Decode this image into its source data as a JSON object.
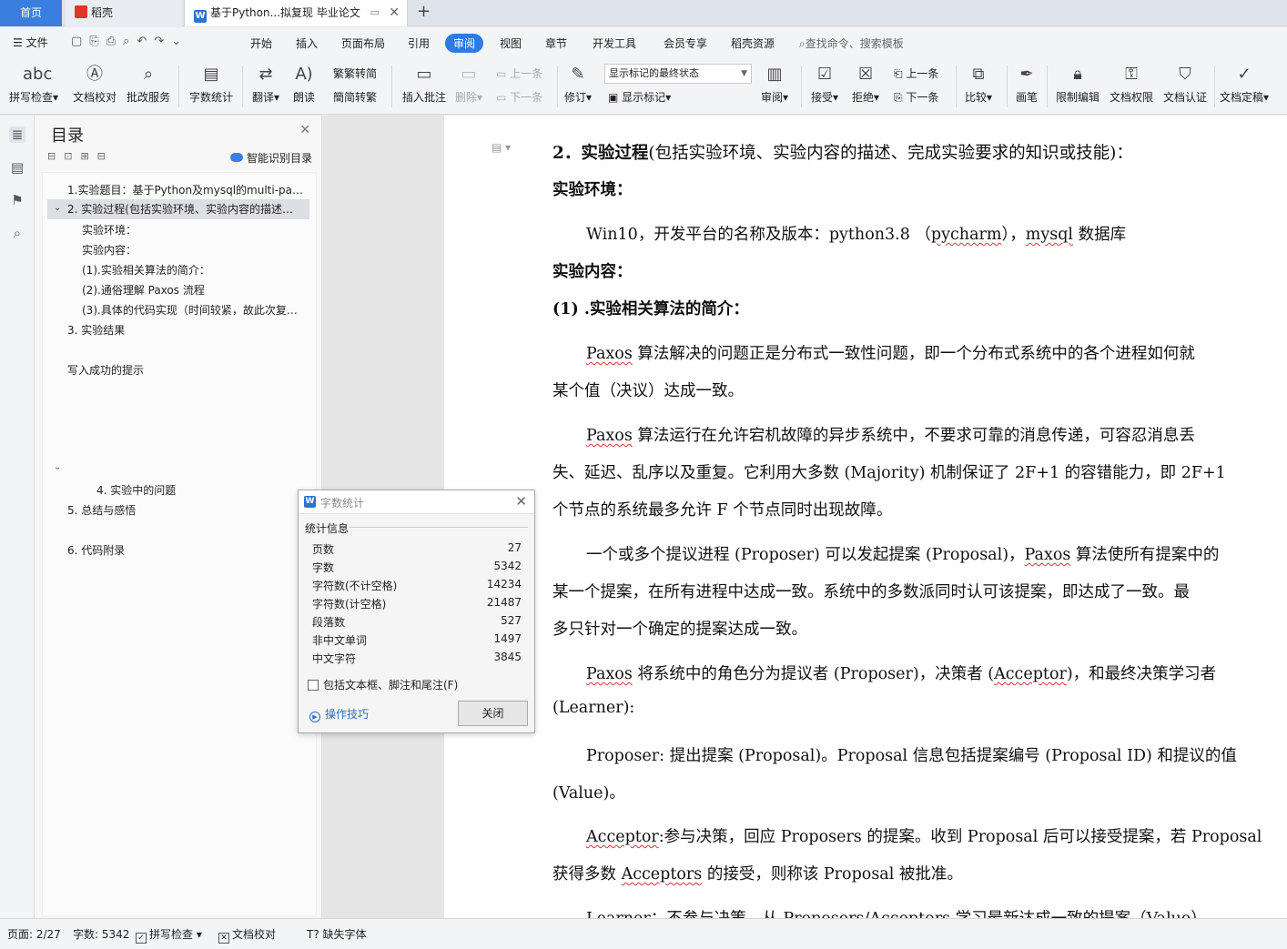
{
  "tabs": {
    "home": "首页",
    "daoke": "稻壳",
    "doc": "基于Python...拟复现 毕业论文"
  },
  "menu": {
    "file": "文件",
    "items": [
      "开始",
      "插入",
      "页面布局",
      "引用",
      "审阅",
      "视图",
      "章节",
      "开发工具",
      "会员专享",
      "稻壳资源"
    ],
    "active": "审阅",
    "search_placeholder": "查找命令、搜索模板"
  },
  "ribbon": {
    "spell": "拼写检查",
    "proof": "文档校对",
    "batch": "批改服务",
    "wordcount": "字数统计",
    "translate": "翻译",
    "read": "朗读",
    "trad": "繁转简",
    "simp": "简转繁",
    "insert_comment": "插入批注",
    "delete": "删除",
    "prev": "上一条",
    "next": "下一条",
    "revise": "修订",
    "markup_select": "显示标记的最终状态",
    "show_markup": "显示标记",
    "review": "审阅",
    "accept": "接受",
    "reject": "拒绝",
    "prev2": "上一条",
    "next2": "下一条",
    "compare": "比较",
    "pen": "画笔",
    "restrict": "限制编辑",
    "permission": "文档权限",
    "certify": "文档认证",
    "finalize": "文档定稿"
  },
  "toc": {
    "title": "目录",
    "smart": "智能识别目录",
    "items": [
      "1.实验题目：基于Python及mysql的multi-pa…",
      "2. 实验过程(包括实验环境、实验内容的描述…",
      "实验环境：",
      "实验内容：",
      "(1).实验相关算法的简介：",
      "(2).通俗理解 Paxos 流程",
      "(3).具体的代码实现（时间较紧，故此次复…",
      "3. 实验结果",
      "写入成功的提示",
      "4. 实验中的问题",
      "5. 总结与感悟",
      "6. 代码附录"
    ]
  },
  "doc": {
    "h2": "2．实验过程",
    "h2_rest": "(包括实验环境、实验内容的描述、完成实验要求的知识或技能)：",
    "env_title": "实验环境：",
    "env_text_a": "Win10，开发平台的名称及版本：python3.8 （",
    "env_pycharm": "pycharm",
    "env_text_b": "），",
    "env_mysql": "mysql",
    "env_text_c": " 数据库",
    "content_title": "实验内容：",
    "algo_title": "(1) .实验相关算法的简介：",
    "paxos": "Paxos",
    "p1a_rest": " 算法解决的问题正是分布式一致性问题，即一个分布式系统中的各个进程如何就",
    "p1b": "某个值（决议）达成一致。",
    "p2a_rest": " 算法运行在允许宕机故障的异步系统中，不要求可靠的消息传递，可容忍消息丢",
    "p2b": "失、延迟、乱序以及重复。它利用大多数 (Majority) 机制保证了 2F+1 的容错能力，即 2F+1",
    "p2c": "个节点的系统最多允许 F 个节点同时出现故障。",
    "p3a_pre": "一个或多个提议进程 (Proposer) 可以发起提案 (Proposal)，",
    "p3a_post": " 算法使所有提案中的",
    "p3b": "某一个提案，在所有进程中达成一致。系统中的多数派同时认可该提案，即达成了一致。最",
    "p3c": "多只针对一个确定的提案达成一致。",
    "p4a_mid": " 将系统中的角色分为提议者 (Proposer)，决策者 (",
    "acceptor": "Acceptor",
    "p4a_end": ")，和最终决策学习者",
    "p4b": "(Learner):",
    "p5a": "Proposer: 提出提案 (Proposal)。Proposal 信息包括提案编号 (Proposal ID) 和提议的值",
    "p5b": "(Value)。",
    "p6a_post": ":参与决策，回应 Proposers 的提案。收到 Proposal 后可以接受提案，若 Proposal",
    "p6b_pre": "获得多数 ",
    "acceptors": "Acceptors",
    "p6b_post": " 的接受，则称该 Proposal 被批准。",
    "p7a": "Learner：不参与决策，从 Proposers/Acceptors 学习最新达成一致的提案（Value）。"
  },
  "dialog": {
    "title": "字数统计",
    "section": "统计信息",
    "stats": [
      {
        "label": "页数",
        "value": "27"
      },
      {
        "label": "字数",
        "value": "5342"
      },
      {
        "label": "字符数(不计空格)",
        "value": "14234"
      },
      {
        "label": "字符数(计空格)",
        "value": "21487"
      },
      {
        "label": "段落数",
        "value": "527"
      },
      {
        "label": "非中文单词",
        "value": "1497"
      },
      {
        "label": "中文字符",
        "value": "3845"
      }
    ],
    "checkbox": "包括文本框、脚注和尾注(F)",
    "tips": "操作技巧",
    "close": "关闭"
  },
  "status": {
    "page": "页面: 2/27",
    "words": "字数: 5342",
    "spell": "拼写检查",
    "proof": "文档校对",
    "font": "缺失字体"
  },
  "colors": {
    "accent": "#2e7ae6",
    "home_tab": "#3a7fe0",
    "spell_wave": "#d33"
  }
}
